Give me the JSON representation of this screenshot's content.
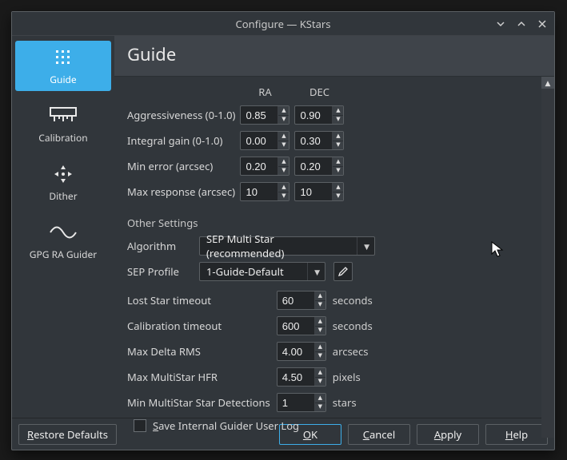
{
  "window": {
    "title": "Configure — KStars"
  },
  "sidebar": {
    "items": [
      {
        "label": "Guide"
      },
      {
        "label": "Calibration"
      },
      {
        "label": "Dither"
      },
      {
        "label": "GPG RA Guider"
      }
    ]
  },
  "main": {
    "title": "Guide",
    "columns": {
      "ra": "RA",
      "dec": "DEC"
    },
    "params": [
      {
        "label": "Aggressiveness (0-1.0)",
        "ra": "0.85",
        "dec": "0.90"
      },
      {
        "label": "Integral gain (0-1.0)",
        "ra": "0.00",
        "dec": "0.30"
      },
      {
        "label": "Min error (arcsec)",
        "ra": "0.20",
        "dec": "0.20"
      },
      {
        "label": "Max response (arcsec)",
        "ra": "10",
        "dec": "10"
      }
    ],
    "other_label": "Other Settings",
    "algorithm": {
      "label": "Algorithm",
      "value": "SEP Multi Star (recommended)"
    },
    "sep_profile": {
      "label": "SEP Profile",
      "value": "1-Guide-Default"
    },
    "settings": [
      {
        "label": "Lost Star timeout",
        "value": "60",
        "unit": "seconds"
      },
      {
        "label": "Calibration timeout",
        "value": "600",
        "unit": "seconds"
      },
      {
        "label": "Max Delta RMS",
        "value": "4.00",
        "unit": "arcsecs"
      },
      {
        "label": "Max MultiStar HFR",
        "value": "4.50",
        "unit": "pixels"
      },
      {
        "label": "Min MultiStar Star Detections",
        "value": "1",
        "unit": "stars"
      }
    ],
    "save_log_label": "Save Internal Guider User Log"
  },
  "buttons": {
    "restore": "Restore Defaults",
    "ok": "OK",
    "cancel": "Cancel",
    "apply": "Apply",
    "help": "Help"
  }
}
